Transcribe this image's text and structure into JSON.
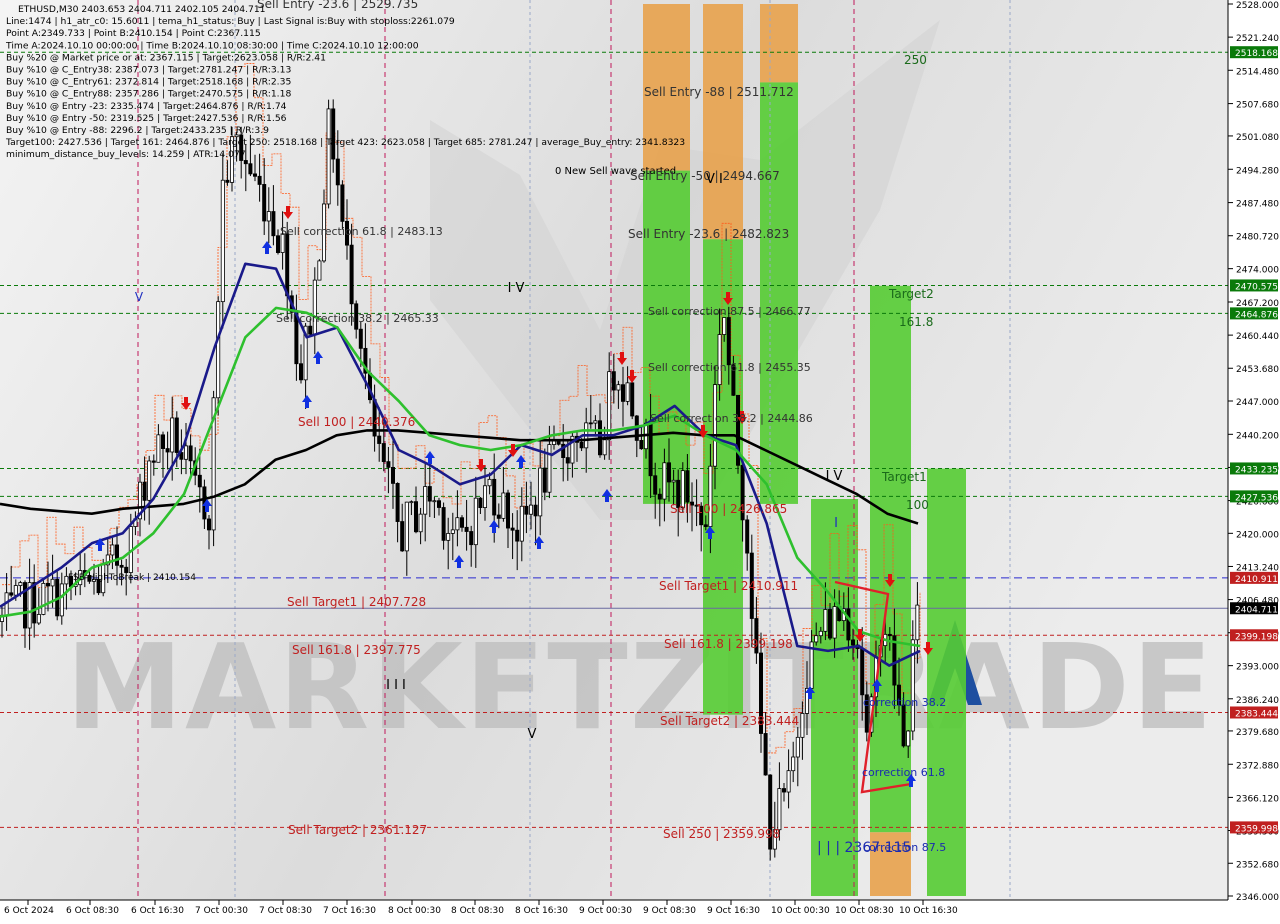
{
  "chart_data": {
    "type": "candlestick",
    "symbol": "ETHUSD,M30",
    "ylim": [
      2346.0,
      2528.0
    ],
    "x_ticks": [
      "6 Oct 2024",
      "6 Oct 08:30",
      "6 Oct 16:30",
      "7 Oct 00:30",
      "7 Oct 08:30",
      "7 Oct 16:30",
      "8 Oct 00:30",
      "8 Oct 08:30",
      "8 Oct 16:30",
      "9 Oct 00:30",
      "9 Oct 08:30",
      "9 Oct 16:30",
      "10 Oct 00:30",
      "10 Oct 08:30",
      "10 Oct 16:30"
    ],
    "y_ticks": [
      "2528.000",
      "2521.240",
      "2514.480",
      "2507.680",
      "2501.080",
      "2494.280",
      "2487.480",
      "2480.720",
      "2474.000",
      "2467.200",
      "2460.440",
      "2453.680",
      "2447.000",
      "2440.200",
      "2433.440",
      "2426.680",
      "2420.000",
      "2413.240",
      "2406.480",
      "2399.720",
      "2393.000",
      "2386.240",
      "2379.680",
      "2372.880",
      "2366.120",
      "2359.360",
      "2352.680",
      "2346.000"
    ],
    "price_labels": [
      {
        "text": "2518.168",
        "value": 2518.168,
        "color": "#0a7a0a"
      },
      {
        "text": "2470.575",
        "value": 2470.575,
        "color": "#0a7a0a"
      },
      {
        "text": "2464.876",
        "value": 2464.876,
        "color": "#0a7a0a"
      },
      {
        "text": "2433.235",
        "value": 2433.235,
        "color": "#0a7a0a"
      },
      {
        "text": "2427.536",
        "value": 2427.536,
        "color": "#0a7a0a"
      },
      {
        "text": "2410.911",
        "value": 2410.911,
        "color": "#c02020"
      },
      {
        "text": "2404.711",
        "value": 2404.711,
        "color": "#000000"
      },
      {
        "text": "2399.198",
        "value": 2399.198,
        "color": "#c02020"
      },
      {
        "text": "2383.444",
        "value": 2383.444,
        "color": "#c02020"
      },
      {
        "text": "2359.998",
        "value": 2359.998,
        "color": "#c02020"
      }
    ],
    "info_lines": [
      "ETHUSD,M30  2403.653 2404.711 2402.105 2404.711",
      "Line:1474 | h1_atr_c0: 15.6011 | tema_h1_status: Buy | Last Signal is:Buy with stoploss:2261.079",
      "Point A:2349.733 | Point B:2410.154 | Point C:2367.115",
      "Time A:2024.10.10 00:00:00 | Time B:2024.10.10 08:30:00 | Time C:2024.10.10 12:00:00",
      "Buy %20 @ Market price or at: 2367.115 | Target:2623.058 | R/R:2.41",
      "Buy %10 @ C_Entry38: 2387.073 | Target:2781.247 | R/R:3.13",
      "Buy %10 @ C_Entry61: 2372.814 | Target:2518.168 | R/R:2.35",
      "Buy %10 @ C_Entry88: 2357.286 | Target:2470.575 | R/R:1.18",
      "Buy %10 @ Entry -23: 2335.474 | Target:2464.876 | R/R:1.74",
      "Buy %10 @ Entry -50: 2319.525 | Target:2427.536 | R/R:1.56",
      "Buy %10 @ Entry -88: 2296.2 | Target:2433.235 | R/R:3.9",
      "Target100: 2427.536 | Target 161: 2464.876 | Target 250: 2518.168 | Target 423: 2623.058 | Target 685: 2781.247 | average_Buy_entry: 2341.8323",
      "minimum_distance_buy_levels: 14.259 | ATR:14.077"
    ],
    "annotations": [
      {
        "text": "Sell Entry -23.6 | 2529.735",
        "color": "#333333"
      },
      {
        "text": "Sell correction 61.8 | 2483.13",
        "color": "#333333"
      },
      {
        "text": "Sell correction 38.2 | 2465.33",
        "color": "#333333"
      },
      {
        "text": "Sell 100 | 2440.376",
        "color": "#c02020"
      },
      {
        "text": "Sell Target1 | 2407.728",
        "color": "#c02020"
      },
      {
        "text": "Sell 161.8 | 2397.775",
        "color": "#c02020"
      },
      {
        "text": "Sell Target2 | 2361.127",
        "color": "#c02020"
      },
      {
        "text": "FSB-HighToBreak | 2410.154",
        "color": "#000000"
      },
      {
        "text": "0 New Sell wave started",
        "color": "#000000"
      },
      {
        "text": "Sell Entry -88 | 2511.712",
        "color": "#333333"
      },
      {
        "text": "Sell Entry -50 | 2494.667",
        "color": "#333333"
      },
      {
        "text": "Sell Entry -23.6 | 2482.823",
        "color": "#333333"
      },
      {
        "text": "Sell correction 87.5 | 2466.77",
        "color": "#333333"
      },
      {
        "text": "Sell correction 61.8 | 2455.35",
        "color": "#333333"
      },
      {
        "text": "Sell correction 38.2 | 2444.86",
        "color": "#333333"
      },
      {
        "text": "Sell 100 | 2426.865",
        "color": "#c02020"
      },
      {
        "text": "Sell Target1 | 2410.911",
        "color": "#c02020"
      },
      {
        "text": "Sell 161.8 | 2399.198",
        "color": "#c02020"
      },
      {
        "text": "Sell Target2 | 2383.444",
        "color": "#c02020"
      },
      {
        "text": "Sell 250 | 2359.998",
        "color": "#c02020"
      },
      {
        "text": "correction 38.2",
        "color": "#1a2ab0"
      },
      {
        "text": "correction 61.8",
        "color": "#1a2ab0"
      },
      {
        "text": "correction 87.5",
        "color": "#1a2ab0"
      },
      {
        "text": "| | | 2367.115",
        "color": "#1a2ab0"
      },
      {
        "text": "Target2",
        "color": "#1a6a1a"
      },
      {
        "text": "161.8",
        "color": "#1a6a1a"
      },
      {
        "text": "Target1",
        "color": "#1a6a1a"
      },
      {
        "text": "100",
        "color": "#1a6a1a"
      },
      {
        "text": "250",
        "color": "#1a6a1a"
      },
      {
        "text": "V",
        "color": "#2030c0"
      },
      {
        "text": "I V",
        "color": "#000000"
      },
      {
        "text": "I I I",
        "color": "#000000"
      },
      {
        "text": "V",
        "color": "#000000"
      },
      {
        "text": "V I",
        "color": "#000000"
      },
      {
        "text": "I V",
        "color": "#000000"
      },
      {
        "text": "I",
        "color": "#2030c0"
      }
    ],
    "series": [
      {
        "name": "",
        "color": "#000000",
        "values": [
          2426,
          2425,
          2424.5,
          2424,
          2425,
          2425.5,
          2426,
          2427.5,
          2430,
          2435,
          2437,
          2440,
          2441,
          2441,
          2440.5,
          2440,
          2439.5,
          2439,
          2439,
          2439,
          2439.5,
          2440,
          2440.5,
          2440,
          2440,
          2437,
          2434,
          2431,
          2428,
          2424,
          2422
        ]
      },
      {
        "name": "",
        "color": "#1a1a8a",
        "values": [
          2405,
          2409,
          2413,
          2418,
          2420,
          2427,
          2438,
          2458,
          2475,
          2474,
          2460,
          2462,
          2450,
          2437,
          2434,
          2430,
          2432,
          2438,
          2436,
          2440,
          2440,
          2442,
          2446,
          2440,
          2438,
          2422,
          2397,
          2396,
          2397,
          2393,
          2396
        ]
      },
      {
        "name": "",
        "color": "#2ec02e",
        "values": [
          2403,
          2404,
          2407,
          2413,
          2415,
          2420,
          2428,
          2444,
          2460,
          2466,
          2465,
          2462,
          2453,
          2447,
          2440,
          2438,
          2437,
          2438,
          2440,
          2441,
          2441,
          2442,
          2444,
          2440,
          2437,
          2430,
          2415,
          2408,
          2400,
          2398,
          2397
        ]
      }
    ]
  },
  "watermark": "MARKETZITRADE"
}
